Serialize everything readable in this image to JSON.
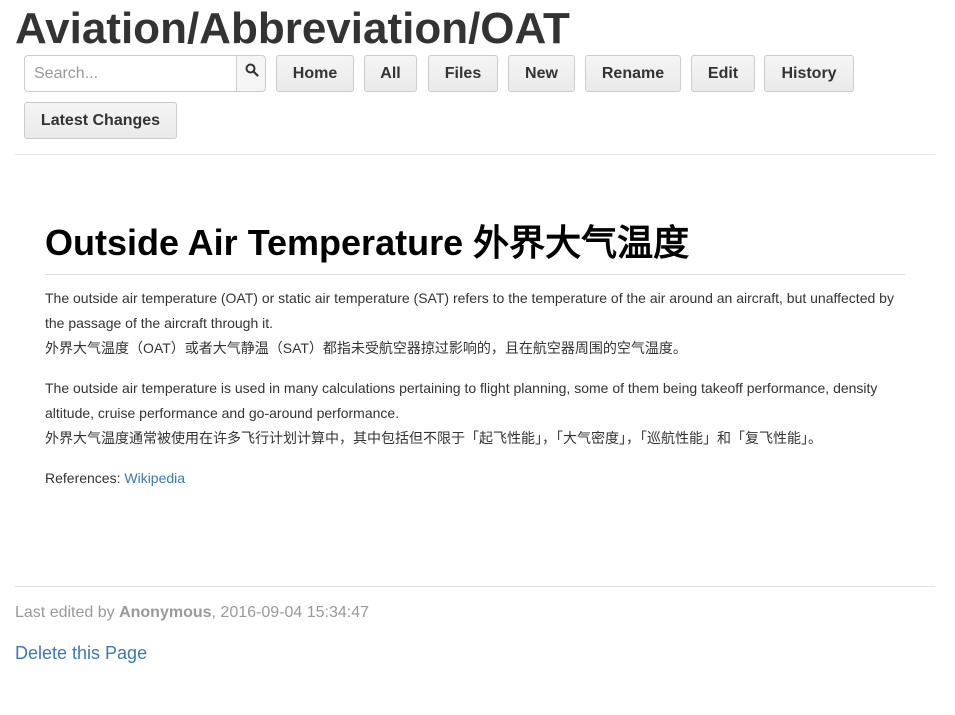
{
  "site": {
    "title": "Aviation/Abbreviation/OAT"
  },
  "search": {
    "placeholder": "Search...",
    "value": "",
    "icon": "search-icon"
  },
  "toolbar": {
    "home_label": "Home",
    "all_label": "All",
    "files_label": "Files",
    "new_label": "New",
    "rename_label": "Rename",
    "edit_label": "Edit",
    "history_label": "History",
    "latest_changes_label": "Latest Changes"
  },
  "article": {
    "heading": "Outside Air Temperature 外界大气温度",
    "p1_en": "The outside air temperature (OAT) or static air temperature (SAT) refers to the temperature of the air around an aircraft, but unaffected by the passage of the aircraft through it.",
    "p1_zh": "外界大气温度（OAT）或者大气静温（SAT）都指未受航空器掠过影响的，且在航空器周围的空气温度。",
    "p2_en": "The outside air temperature is used in many calculations pertaining to flight planning, some of them being takeoff performance, density altitude, cruise performance and go-around performance.",
    "p2_zh": "外界大气温度通常被使用在许多飞行计划计算中，其中包括但不限于「起飞性能」，「大气密度」，「巡航性能」和「复飞性能」。",
    "refs_label": "References: ",
    "refs_link": "Wikipedia"
  },
  "footer": {
    "edited_prefix": "Last edited by ",
    "author": "Anonymous",
    "edited_time": ", 2016-09-04 15:34:47",
    "delete_label": "Delete this Page"
  },
  "colors": {
    "link": "#3c78b4",
    "muted": "#999999",
    "text": "#333333"
  }
}
